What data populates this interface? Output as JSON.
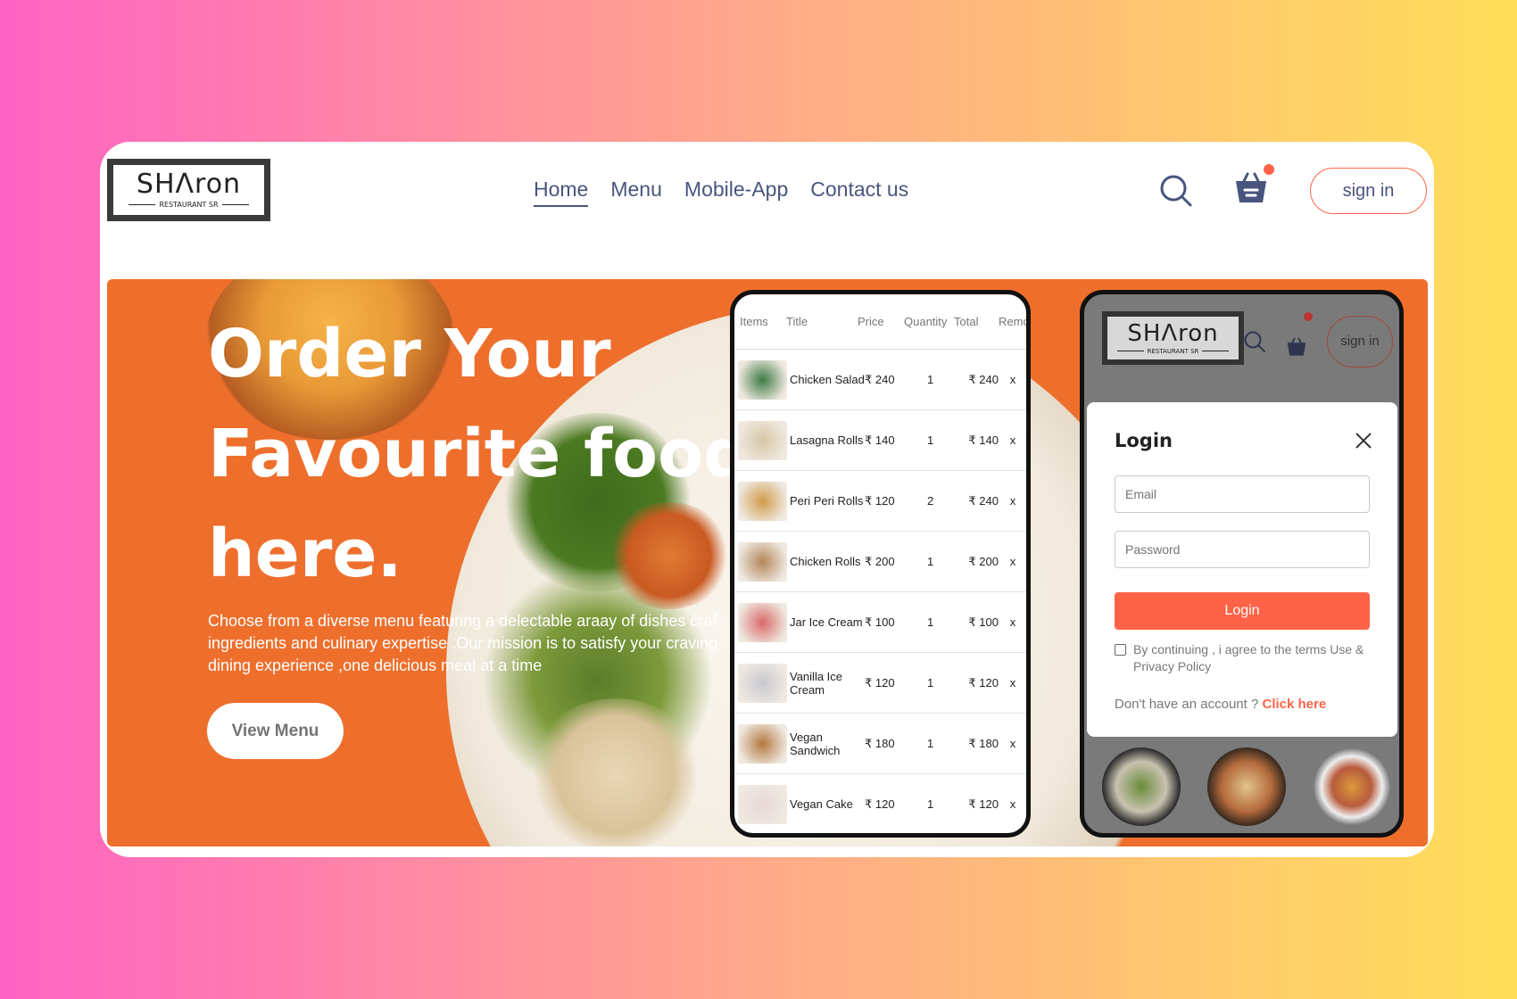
{
  "brand": {
    "logo_word": "SHΛron",
    "logo_sub": "RESTAURANT SR"
  },
  "nav": {
    "items": [
      "Home",
      "Menu",
      "Mobile-App",
      "Contact us"
    ],
    "active": "Home"
  },
  "header": {
    "signin_label": "sign in"
  },
  "hero": {
    "title": "Order Your Favourite food here.",
    "text": "Choose from a diverse menu featuring a delectable araay of dishes craf ingredients and culinary expertise .Our mission is to satisfy your craving dining experience ,one delicious meal at a time",
    "button_label": "View Menu"
  },
  "cart": {
    "headers": [
      "Items",
      "Title",
      "Price",
      "Quantity",
      "Total",
      "Remo"
    ],
    "rows": [
      {
        "title": "Chicken Salad",
        "price": "₹ 240",
        "quantity": "1",
        "total": "₹ 240",
        "remove": "x"
      },
      {
        "title": "Lasagna Rolls",
        "price": "₹ 140",
        "quantity": "1",
        "total": "₹ 140",
        "remove": "x"
      },
      {
        "title": "Peri Peri Rolls",
        "price": "₹ 120",
        "quantity": "2",
        "total": "₹ 240",
        "remove": "x"
      },
      {
        "title": "Chicken Rolls",
        "price": "₹ 200",
        "quantity": "1",
        "total": "₹ 200",
        "remove": "x"
      },
      {
        "title": "Jar Ice Cream",
        "price": "₹ 100",
        "quantity": "1",
        "total": "₹ 100",
        "remove": "x"
      },
      {
        "title": "Vanilla Ice Cream",
        "price": "₹ 120",
        "quantity": "1",
        "total": "₹ 120",
        "remove": "x"
      },
      {
        "title": "Vegan Sandwich",
        "price": "₹ 180",
        "quantity": "1",
        "total": "₹ 180",
        "remove": "x"
      },
      {
        "title": "Vegan Cake",
        "price": "₹ 120",
        "quantity": "1",
        "total": "₹ 120",
        "remove": "x"
      }
    ]
  },
  "mobile": {
    "signin_label": "sign in"
  },
  "login": {
    "title": "Login",
    "email_placeholder": "Email",
    "password_placeholder": "Password",
    "button_label": "Login",
    "terms": "By continuing , i agree to the terms Use & Privacy Policy",
    "signup_prompt": "Don't have an account ?",
    "signup_link": "Click here"
  },
  "colors": {
    "accent": "#ff6347",
    "nav_text": "#49557e",
    "hero_bg": "#ee6f2c"
  },
  "icons": [
    "search-icon",
    "basket-icon",
    "close-icon"
  ]
}
